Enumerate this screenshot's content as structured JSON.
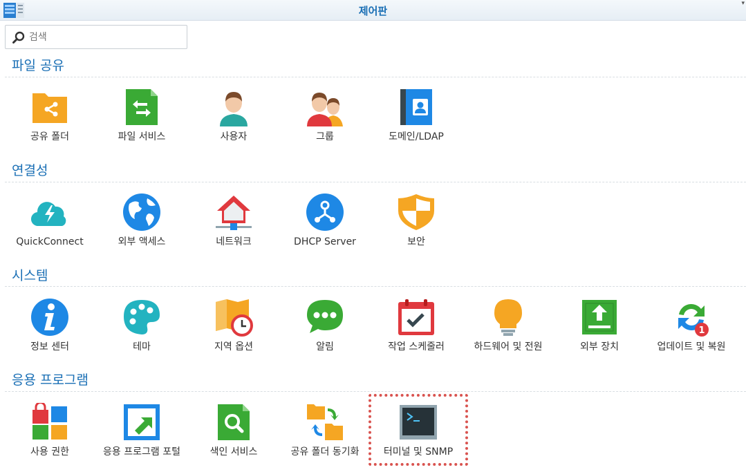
{
  "window": {
    "title": "제어판"
  },
  "search": {
    "placeholder": "검색"
  },
  "sections": [
    {
      "title": "파일 공유",
      "items": [
        {
          "label": "공유 폴더"
        },
        {
          "label": "파일 서비스"
        },
        {
          "label": "사용자"
        },
        {
          "label": "그룹"
        },
        {
          "label": "도메인/LDAP"
        }
      ]
    },
    {
      "title": "연결성",
      "items": [
        {
          "label": "QuickConnect"
        },
        {
          "label": "외부 액세스"
        },
        {
          "label": "네트워크"
        },
        {
          "label": "DHCP Server"
        },
        {
          "label": "보안"
        }
      ]
    },
    {
      "title": "시스템",
      "items": [
        {
          "label": "정보 센터"
        },
        {
          "label": "테마"
        },
        {
          "label": "지역 옵션"
        },
        {
          "label": "알림"
        },
        {
          "label": "작업 스케줄러"
        },
        {
          "label": "하드웨어 및 전원"
        },
        {
          "label": "외부 장치"
        },
        {
          "label": "업데이트 및 복원",
          "badge": "1"
        }
      ]
    },
    {
      "title": "응용 프로그램",
      "items": [
        {
          "label": "사용 권한"
        },
        {
          "label": "응용 프로그램 포털"
        },
        {
          "label": "색인 서비스"
        },
        {
          "label": "공유 폴더 동기화"
        },
        {
          "label": "터미널 및 SNMP",
          "selected": true
        }
      ]
    }
  ],
  "colors": {
    "accent": "#1a6fb5",
    "selection": "#d9534f"
  }
}
